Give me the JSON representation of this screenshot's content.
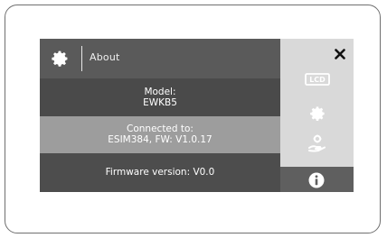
{
  "header": {
    "title": "About"
  },
  "rows": {
    "model_label": "Model:",
    "model_value": "EWKB5",
    "connected_label": "Connected to:",
    "connected_value": "ESIM384, FW: V1.0.17",
    "firmware": "Firmware version: V0.0"
  },
  "sidebar": {
    "lcd_label": "LCD",
    "icons": [
      "close-icon",
      "lcd-icon",
      "gear-icon",
      "hand-service-icon",
      "info-icon"
    ],
    "active_item": "info"
  },
  "colors": {
    "header_bg": "#5a5a5a",
    "row_dark": "#4a4a4a",
    "row_mid": "#9d9d9d",
    "sidebar_bg": "#d9d9d9",
    "sidebar_active": "#5f5f5f",
    "frame": "#6f6f6f"
  }
}
